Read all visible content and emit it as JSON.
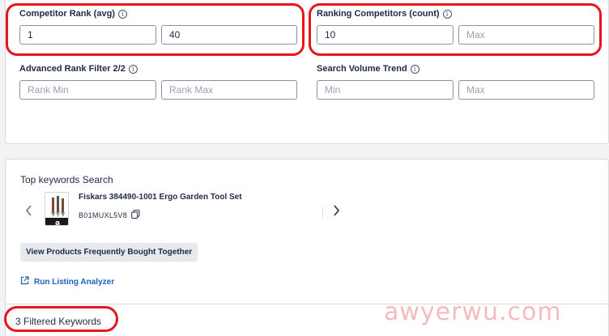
{
  "filters": {
    "competitor_rank": {
      "label": "Competitor Rank (avg)",
      "min_value": "1",
      "max_value": "40"
    },
    "ranking_competitors": {
      "label": "Ranking Competitors (count)",
      "min_value": "10",
      "max_placeholder": "Max"
    },
    "advanced_rank": {
      "label": "Advanced Rank Filter 2/2",
      "min_placeholder": "Rank Min",
      "max_placeholder": "Rank Max"
    },
    "search_volume_trend": {
      "label": "Search Volume Trend",
      "min_placeholder": "Min",
      "max_placeholder": "Max"
    }
  },
  "top_keywords": {
    "title": "Top keywords Search",
    "product_name": "Fiskars 384490-1001 Ergo Garden Tool Set",
    "asin": "B01MUXL5V8",
    "fbt_button": "View Products Frequently Bought Together",
    "analyzer_link": "Run Listing Analyzer"
  },
  "results": {
    "filtered_keywords": "3 Filtered Keywords"
  },
  "watermark": "awyerwu.com",
  "colors": {
    "highlight": "#e8151b",
    "link": "#1f5fbf",
    "text": "#1f2a44"
  }
}
